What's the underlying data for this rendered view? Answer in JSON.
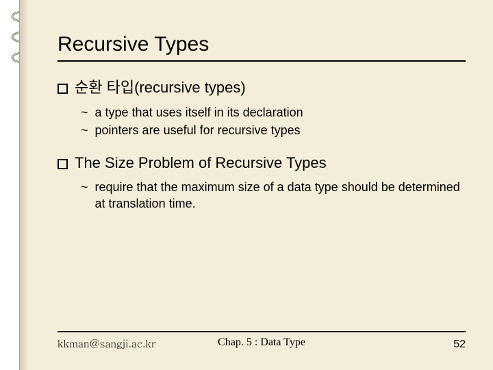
{
  "title": "Recursive Types",
  "sections": [
    {
      "heading": "순환 타입(recursive types)",
      "items": [
        "a type that uses itself in its declaration",
        "pointers are useful for recursive types"
      ]
    },
    {
      "heading": "The Size Problem of Recursive Types",
      "items": [
        "require that the maximum size of a data type should be determined at translation time."
      ]
    }
  ],
  "footer": {
    "left": "kkman@sangji.ac.kr",
    "center": "Chap. 5 : Data Type",
    "page": "52"
  }
}
